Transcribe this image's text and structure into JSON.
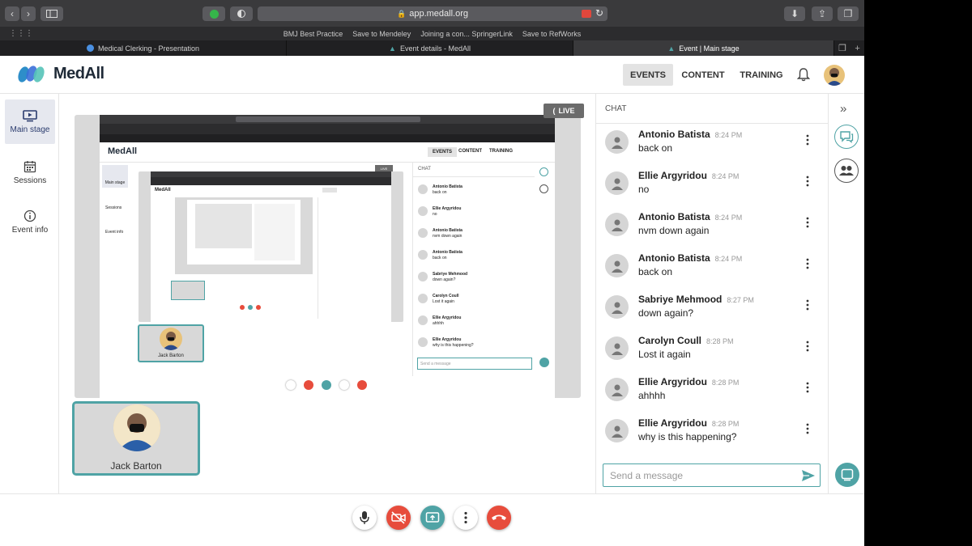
{
  "browser": {
    "url": "app.medall.org",
    "bookmarks": [
      "BMJ Best Practice",
      "Save to Mendeley",
      "Joining a con... SpringerLink",
      "Save to RefWorks"
    ],
    "tabs": [
      {
        "label": "Medical Clerking - Presentation",
        "active": false
      },
      {
        "label": "Event details - MedAll",
        "active": false
      },
      {
        "label": "Event | Main stage",
        "active": true
      }
    ]
  },
  "header": {
    "brand": "MedAll",
    "nav": [
      {
        "label": "EVENTS",
        "active": true
      },
      {
        "label": "CONTENT",
        "active": false
      },
      {
        "label": "TRAINING",
        "active": false
      }
    ],
    "icons": [
      "bell-icon",
      "user-avatar"
    ]
  },
  "leftnav": {
    "items": [
      {
        "label": "Main stage",
        "icon": "screen-play-icon",
        "active": true
      },
      {
        "label": "Sessions",
        "icon": "calendar-icon",
        "active": false
      },
      {
        "label": "Event info",
        "icon": "info-icon",
        "active": false
      }
    ]
  },
  "stage": {
    "live_label": "LIVE",
    "self_name": "Jack Barton",
    "nested": {
      "chat_label": "CHAT",
      "nav": [
        "EVENTS",
        "CONTENT",
        "TRAINING"
      ],
      "leftnav": [
        "Main stage",
        "Sessions",
        "Event info"
      ],
      "send_placeholder": "Send a message"
    }
  },
  "chat": {
    "title": "CHAT",
    "messages": [
      {
        "name": "Antonio Batista",
        "time": "8:24 PM",
        "text": "back on"
      },
      {
        "name": "Ellie Argyridou",
        "time": "8:24 PM",
        "text": "no"
      },
      {
        "name": "Antonio Batista",
        "time": "8:24 PM",
        "text": "nvm down again"
      },
      {
        "name": "Antonio Batista",
        "time": "8:24 PM",
        "text": "back on"
      },
      {
        "name": "Sabriye Mehmood",
        "time": "8:27 PM",
        "text": "down again?"
      },
      {
        "name": "Carolyn Coull",
        "time": "8:28 PM",
        "text": "Lost it again"
      },
      {
        "name": "Ellie Argyridou",
        "time": "8:28 PM",
        "text": "ahhhh"
      },
      {
        "name": "Ellie Argyridou",
        "time": "8:28 PM",
        "text": "why is this happening?"
      }
    ],
    "input_placeholder": "Send a message"
  },
  "controls": [
    "microphone-icon",
    "camera-off-icon",
    "screen-share-icon",
    "more-icon",
    "hang-up-icon"
  ],
  "colors": {
    "accent": "#4fa3a5",
    "danger": "#e74c3c",
    "brand_dark": "#1f2a37"
  }
}
